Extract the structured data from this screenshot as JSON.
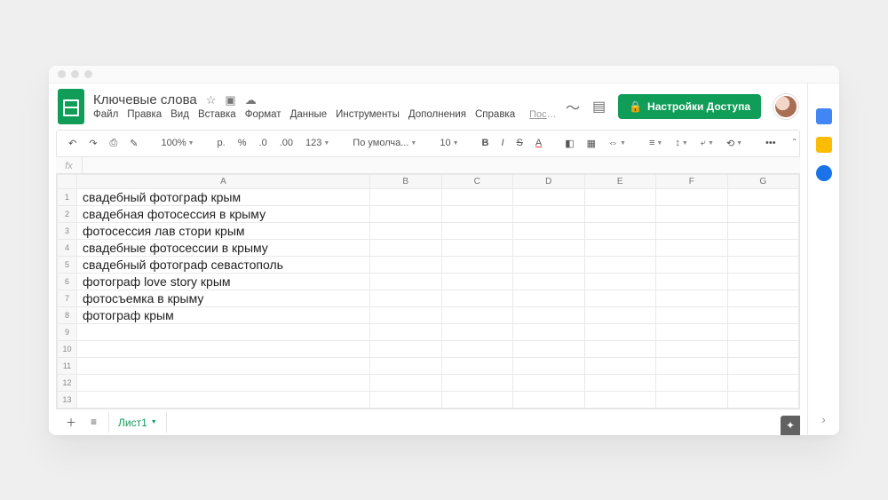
{
  "doc": {
    "title": "Ключевые слова",
    "last_edit": "Последнее измене..."
  },
  "menus": {
    "file": "Файл",
    "edit": "Правка",
    "view": "Вид",
    "insert": "Вставка",
    "format": "Формат",
    "data": "Данные",
    "tools": "Инструменты",
    "addons": "Дополнения",
    "help": "Справка"
  },
  "share": {
    "label": "Настройки Доступа"
  },
  "toolbar": {
    "zoom": "100%",
    "currency": "р.",
    "percent": "%",
    "dec_dec": ".0",
    "dec_inc": ".00",
    "num_fmt": "123",
    "font": "По умолча...",
    "font_size": "10",
    "more": "•••"
  },
  "fx": {
    "label": "fx",
    "value": ""
  },
  "columns": [
    "A",
    "B",
    "C",
    "D",
    "E",
    "F",
    "G"
  ],
  "rows": [
    {
      "n": "1",
      "a": "свадебный фотограф крым"
    },
    {
      "n": "2",
      "a": "свадебная фотосессия в крыму"
    },
    {
      "n": "3",
      "a": "фотосессия лав стори крым"
    },
    {
      "n": "4",
      "a": "свадебные фотосессии в крыму"
    },
    {
      "n": "5",
      "a": "свадебный фотограф севастополь"
    },
    {
      "n": "6",
      "a": "фотограф love story крым"
    },
    {
      "n": "7",
      "a": "фотосъемка в крыму"
    },
    {
      "n": "8",
      "a": "фотограф крым"
    },
    {
      "n": "9",
      "a": ""
    },
    {
      "n": "10",
      "a": ""
    },
    {
      "n": "11",
      "a": ""
    },
    {
      "n": "12",
      "a": ""
    },
    {
      "n": "13",
      "a": ""
    }
  ],
  "tabs": {
    "sheet1": "Лист1"
  }
}
